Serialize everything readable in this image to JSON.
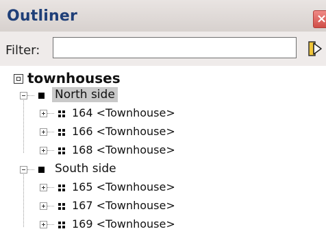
{
  "panel": {
    "title": "Outliner",
    "close_symbol": "×"
  },
  "filter": {
    "label": "Filter:",
    "value": "",
    "placeholder": ""
  },
  "tree": {
    "root": {
      "label": "townhouses"
    },
    "groups": [
      {
        "label": "North side",
        "selected": true,
        "items": [
          "164 <Townhouse>",
          "166 <Townhouse>",
          "168 <Townhouse>"
        ]
      },
      {
        "label": "South side",
        "selected": false,
        "items": [
          "165 <Townhouse>",
          "167 <Townhouse>",
          "169 <Townhouse>"
        ]
      }
    ]
  },
  "colors": {
    "title": "#1f3f78",
    "selection": "#c9c9c9",
    "close": "#d04e48"
  }
}
